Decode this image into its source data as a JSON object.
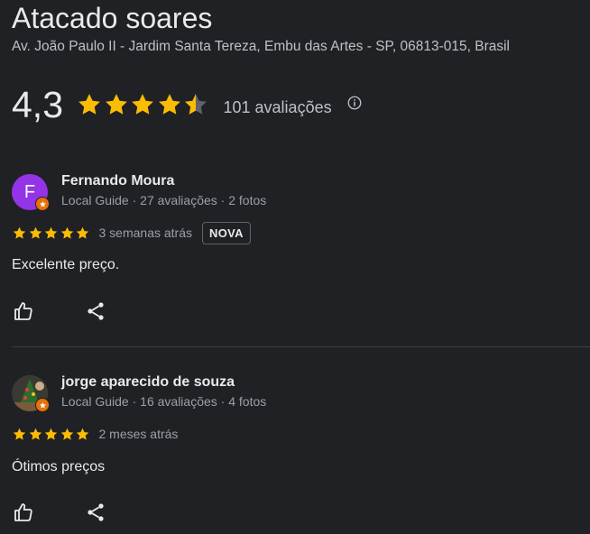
{
  "place": {
    "title": "Atacado soares",
    "address": "Av. João Paulo II - Jardim Santa Tereza, Embu das Artes - SP, 06813-015, Brasil",
    "rating": "4,3",
    "rating_value": 4.3,
    "reviews_count": "101 avaliações"
  },
  "colors": {
    "background": "#202124",
    "star": "#fbbc04",
    "star_empty": "#5f6368",
    "text_primary": "#e8eaed",
    "text_secondary": "#9aa0a6",
    "avatar_purple": "#9334e6",
    "local_guide_badge": "#e8710a"
  },
  "reviews": [
    {
      "avatar_letter": "F",
      "name": "Fernando Moura",
      "meta": "Local Guide · 27 avaliações · 2 fotos",
      "stars": 5,
      "date": "3 semanas atrás",
      "badge": "NOVA",
      "text": "Excelente preço.",
      "icons": [
        "thumbs-up-icon",
        "share-icon"
      ]
    },
    {
      "avatar_letter": "",
      "name": "jorge aparecido de souza",
      "meta": "Local Guide · 16 avaliações · 4 fotos",
      "stars": 5,
      "date": "2 meses atrás",
      "text": "Ótimos preços",
      "icons": [
        "thumbs-up-icon",
        "share-icon"
      ]
    }
  ]
}
